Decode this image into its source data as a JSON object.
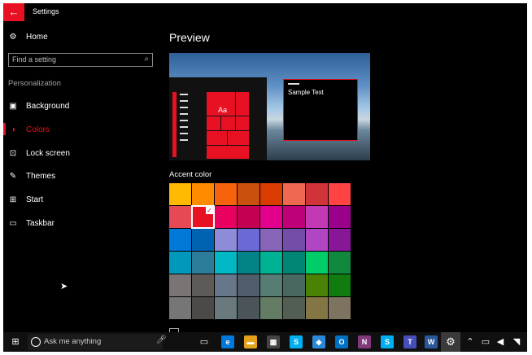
{
  "window": {
    "title": "Settings",
    "back_glyph": "←"
  },
  "nav": {
    "home": "Home",
    "search_placeholder": "Find a setting",
    "section": "Personalization",
    "items": [
      {
        "label": "Background",
        "icon": "image-icon"
      },
      {
        "label": "Colors",
        "icon": "palette-icon",
        "selected": true
      },
      {
        "label": "Lock screen",
        "icon": "lock-screen-icon"
      },
      {
        "label": "Themes",
        "icon": "themes-icon"
      },
      {
        "label": "Start",
        "icon": "start-icon"
      },
      {
        "label": "Taskbar",
        "icon": "taskbar-icon"
      }
    ]
  },
  "preview": {
    "title": "Preview",
    "tile_text": "Aa",
    "sample_text": "Sample Text"
  },
  "accent": {
    "title": "Accent color",
    "selected": "#e81123",
    "colors": [
      [
        "#ffb900",
        "#ff8c00",
        "#f7630c",
        "#ca5010",
        "#da3b01",
        "#ef6950",
        "#d13438",
        "#ff4343"
      ],
      [
        "#e74856",
        "#e81123",
        "#ea005e",
        "#c30052",
        "#e3008c",
        "#bf0077",
        "#c239b3",
        "#9a0089"
      ],
      [
        "#0078d7",
        "#0063b1",
        "#8e8cd8",
        "#6b69d6",
        "#8764b8",
        "#744da9",
        "#b146c2",
        "#881798"
      ],
      [
        "#0099bc",
        "#2d7d9a",
        "#00b7c3",
        "#038387",
        "#00b294",
        "#018574",
        "#00cc6a",
        "#10893e"
      ],
      [
        "#7a7574",
        "#5d5a58",
        "#68768a",
        "#515c6b",
        "#567c73",
        "#486860",
        "#498205",
        "#107c10"
      ],
      [
        "#767676",
        "#4c4a48",
        "#69797e",
        "#4a5459",
        "#647c64",
        "#525e54",
        "#847545",
        "#7e735f"
      ]
    ]
  },
  "taskbar": {
    "search_text": "Ask me anything"
  }
}
